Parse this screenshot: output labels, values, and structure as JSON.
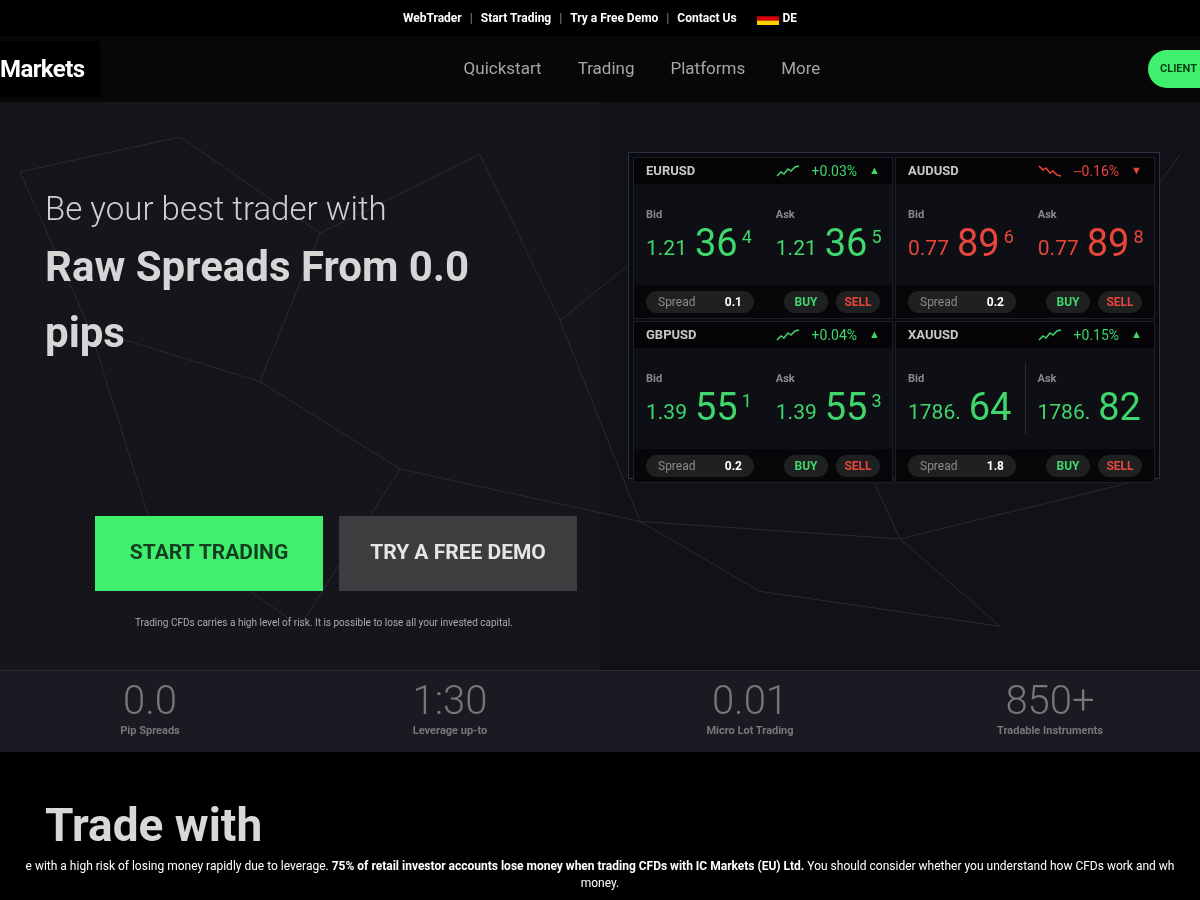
{
  "top_links": [
    "WebTrader",
    "Start Trading",
    "Try a Free Demo",
    "Contact Us"
  ],
  "separator": "|",
  "language": "DE",
  "logo": "Markets",
  "nav": [
    "Quickstart",
    "Trading",
    "Platforms",
    "More"
  ],
  "client_button": "CLIENT",
  "hero": {
    "kicker": "Be your best trader with",
    "headline": "Raw Spreads From 0.0 pips",
    "primary_button": "START TRADING",
    "secondary_button": "TRY A FREE DEMO",
    "risk_note": "Trading CFDs carries a high level of risk. It is possible to lose all your invested capital."
  },
  "quotes": [
    {
      "symbol": "EURUSD",
      "change": "+0.03%",
      "rising": true,
      "arrow": "▲",
      "bid": {
        "label": "Bid",
        "base": "1.21",
        "big": "36",
        "pip": "4"
      },
      "ask": {
        "label": "Ask",
        "base": "1.21",
        "big": "36",
        "pip": "5"
      },
      "spread_label": "Spread",
      "spread": "0.1",
      "buy": "BUY",
      "sell": "SELL"
    },
    {
      "symbol": "AUDUSD",
      "change": "--0.16%",
      "rising": false,
      "arrow": "▼",
      "bid": {
        "label": "Bid",
        "base": "0.77",
        "big": "89",
        "pip": "6"
      },
      "ask": {
        "label": "Ask",
        "base": "0.77",
        "big": "89",
        "pip": "8"
      },
      "spread_label": "Spread",
      "spread": "0.2",
      "buy": "BUY",
      "sell": "SELL"
    },
    {
      "symbol": "GBPUSD",
      "change": "+0.04%",
      "rising": true,
      "arrow": "▲",
      "bid": {
        "label": "Bid",
        "base": "1.39",
        "big": "55",
        "pip": "1"
      },
      "ask": {
        "label": "Ask",
        "base": "1.39",
        "big": "55",
        "pip": "3"
      },
      "spread_label": "Spread",
      "spread": "0.2",
      "buy": "BUY",
      "sell": "SELL"
    },
    {
      "symbol": "XAUUSD",
      "change": "+0.15%",
      "rising": true,
      "arrow": "▲",
      "bid": {
        "label": "Bid",
        "base": "1786.",
        "big": "64"
      },
      "ask": {
        "label": "Ask",
        "base": "1786.",
        "big": "82"
      },
      "spread_label": "Spread",
      "spread": "1.8",
      "buy": "BUY",
      "sell": "SELL"
    }
  ],
  "stats": [
    {
      "value": "0.0",
      "label": "Pip Spreads"
    },
    {
      "value": "1:30",
      "label": "Leverage up-to"
    },
    {
      "value": "0.01",
      "label": "Micro Lot Trading"
    },
    {
      "value": "850+",
      "label": "Tradable Instruments"
    }
  ],
  "section_heading": "Trade with",
  "risk_banner": [
    "e with a high risk of losing money rapidly due to leverage. **75% of retail investor accounts lose money when trading CFDs with IC Markets (EU) Ltd.** You should consider whether you understand how CFDs work and wh",
    "money."
  ]
}
